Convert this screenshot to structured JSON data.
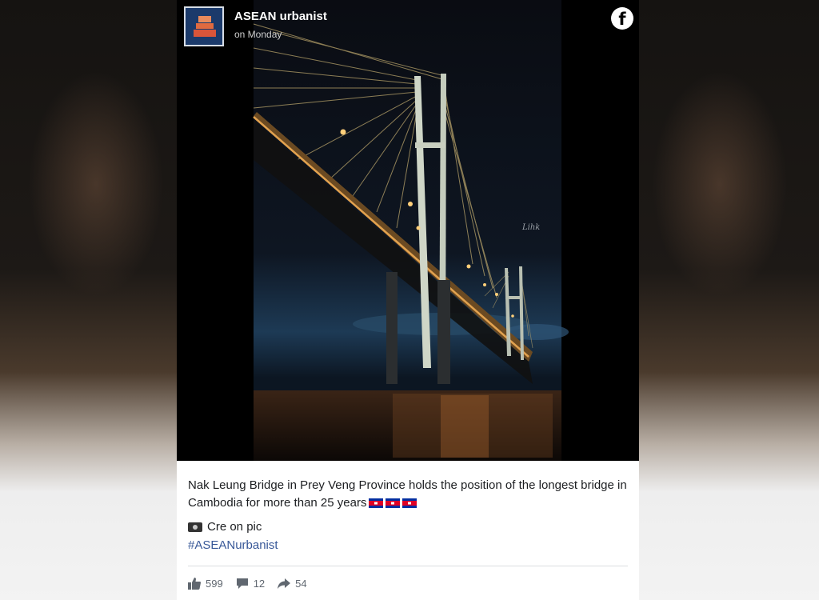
{
  "post": {
    "page_name": "ASEAN urbanist",
    "time": "on Monday",
    "photo_alt": "Nak Leung Bridge at night",
    "caption": "Nak Leung Bridge in Prey Veng Province holds the position of the longest bridge in Cambodia for more than 25 years",
    "credit": "Cre on pic",
    "hashtag": "#ASEANurbanist",
    "stats": {
      "likes": "599",
      "comments": "12",
      "shares": "54"
    }
  },
  "colors": {
    "card_bg": "#000000",
    "link": "#385898",
    "text": "#1c1e21",
    "muted": "#606770",
    "avatar_bg": "#1b3a6b"
  },
  "icons": [
    "facebook-icon",
    "like-icon",
    "comment-icon",
    "share-icon",
    "camera-icon",
    "cambodia-flag-icon"
  ]
}
